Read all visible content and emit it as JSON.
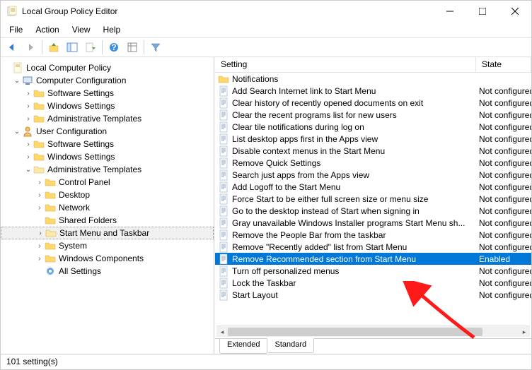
{
  "window": {
    "title": "Local Group Policy Editor"
  },
  "menus": [
    "File",
    "Action",
    "View",
    "Help"
  ],
  "tree": {
    "root": "Local Computer Policy",
    "computerConfig": "Computer Configuration",
    "ccSoftware": "Software Settings",
    "ccWindows": "Windows Settings",
    "ccAdmin": "Administrative Templates",
    "userConfig": "User Configuration",
    "ucSoftware": "Software Settings",
    "ucWindows": "Windows Settings",
    "ucAdmin": "Administrative Templates",
    "cp": "Control Panel",
    "desktop": "Desktop",
    "network": "Network",
    "shared": "Shared Folders",
    "startMenu": "Start Menu and Taskbar",
    "system": "System",
    "winComp": "Windows Components",
    "allSettings": "All Settings"
  },
  "columns": {
    "setting": "Setting",
    "state": "State"
  },
  "settings": [
    {
      "kind": "folder",
      "name": "Notifications",
      "state": ""
    },
    {
      "kind": "policy",
      "name": "Add Search Internet link to Start Menu",
      "state": "Not configured"
    },
    {
      "kind": "policy",
      "name": "Clear history of recently opened documents on exit",
      "state": "Not configured"
    },
    {
      "kind": "policy",
      "name": "Clear the recent programs list for new users",
      "state": "Not configured"
    },
    {
      "kind": "policy",
      "name": "Clear tile notifications during log on",
      "state": "Not configured"
    },
    {
      "kind": "policy",
      "name": "List desktop apps first in the Apps view",
      "state": "Not configured"
    },
    {
      "kind": "policy",
      "name": "Disable context menus in the Start Menu",
      "state": "Not configured"
    },
    {
      "kind": "policy",
      "name": "Remove Quick Settings",
      "state": "Not configured"
    },
    {
      "kind": "policy",
      "name": "Search just apps from the Apps view",
      "state": "Not configured"
    },
    {
      "kind": "policy",
      "name": "Add Logoff to the Start Menu",
      "state": "Not configured"
    },
    {
      "kind": "policy",
      "name": "Force Start to be either full screen size or menu size",
      "state": "Not configured"
    },
    {
      "kind": "policy",
      "name": "Go to the desktop instead of Start when signing in",
      "state": "Not configured"
    },
    {
      "kind": "policy",
      "name": "Gray unavailable Windows Installer programs Start Menu sh...",
      "state": "Not configured"
    },
    {
      "kind": "policy",
      "name": "Remove the People Bar from the taskbar",
      "state": "Not configured"
    },
    {
      "kind": "policy",
      "name": "Remove \"Recently added\" list from Start Menu",
      "state": "Not configured"
    },
    {
      "kind": "policy",
      "name": "Remove Recommended section from Start Menu",
      "state": "Enabled",
      "selected": true
    },
    {
      "kind": "policy",
      "name": "Turn off personalized menus",
      "state": "Not configured"
    },
    {
      "kind": "policy",
      "name": "Lock the Taskbar",
      "state": "Not configured"
    },
    {
      "kind": "policy",
      "name": "Start Layout",
      "state": "Not configured"
    }
  ],
  "tabs": {
    "extended": "Extended",
    "standard": "Standard"
  },
  "status": "101 setting(s)"
}
